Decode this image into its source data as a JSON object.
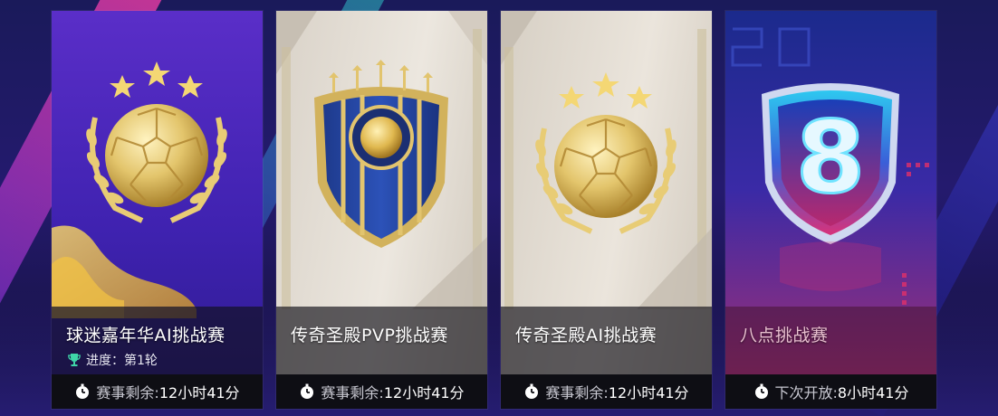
{
  "cards": [
    {
      "title": "球迷嘉年华AI挑战赛",
      "progress": "进度：第1轮",
      "footer_label": "赛事剩余:",
      "footer_time": "12小时41分",
      "badge": "gold-football-laurel-three-stars"
    },
    {
      "title": "传奇圣殿PVP挑战赛",
      "footer_label": "赛事剩余:",
      "footer_time": "12小时41分",
      "badge": "blue-gold-shield-crest"
    },
    {
      "title": "传奇圣殿AI挑战赛",
      "footer_label": "赛事剩余:",
      "footer_time": "12小时41分",
      "badge": "gold-football-laurel-three-stars"
    },
    {
      "title": "八点挑战赛",
      "footer_label": "下次开放:",
      "footer_time": "8小时41分",
      "badge": "neon-shield-number-8",
      "badge_text": "8"
    }
  ],
  "colors": {
    "card1_bg": "#4a28bc",
    "card4_bg": "#3a2aa6",
    "gold": "#e8c96a",
    "footer_bg": "#0e0e14"
  }
}
